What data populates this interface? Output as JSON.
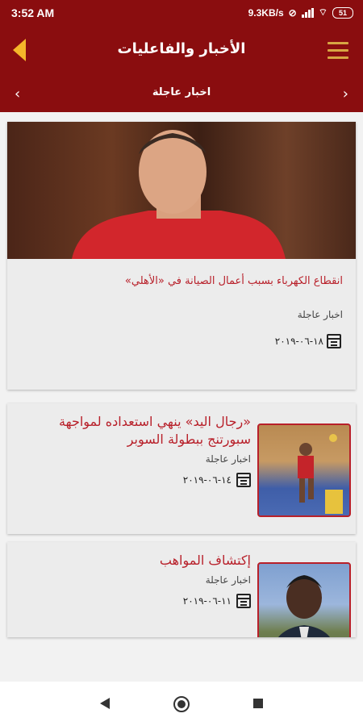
{
  "status": {
    "time": "3:52 AM",
    "speed": "9.3KB/s",
    "battery": "51"
  },
  "appbar": {
    "title": "الأخبار والفاعليات"
  },
  "subbar": {
    "category": "اخبار عاجلة"
  },
  "articles": [
    {
      "headline": "انقطاع الكهرباء بسبب أعمال الصيانة في «الأهلي»",
      "category": "اخبار عاجلة",
      "date": "١٨-٠٦-٢٠١٩"
    },
    {
      "headline": "«رجال اليد» ينهي استعداده لمواجهة سبورتنج ببطولة السوبر",
      "category": "اخبار عاجلة",
      "date": "١٤-٠٦-٢٠١٩"
    },
    {
      "headline": "إكتشاف المواهب",
      "category": "اخبار عاجلة",
      "date": "١١-٠٦-٢٠١٩"
    }
  ],
  "colors": {
    "primary": "#8a0d0f",
    "accent": "#f5b62a",
    "headline": "#b8202a"
  }
}
